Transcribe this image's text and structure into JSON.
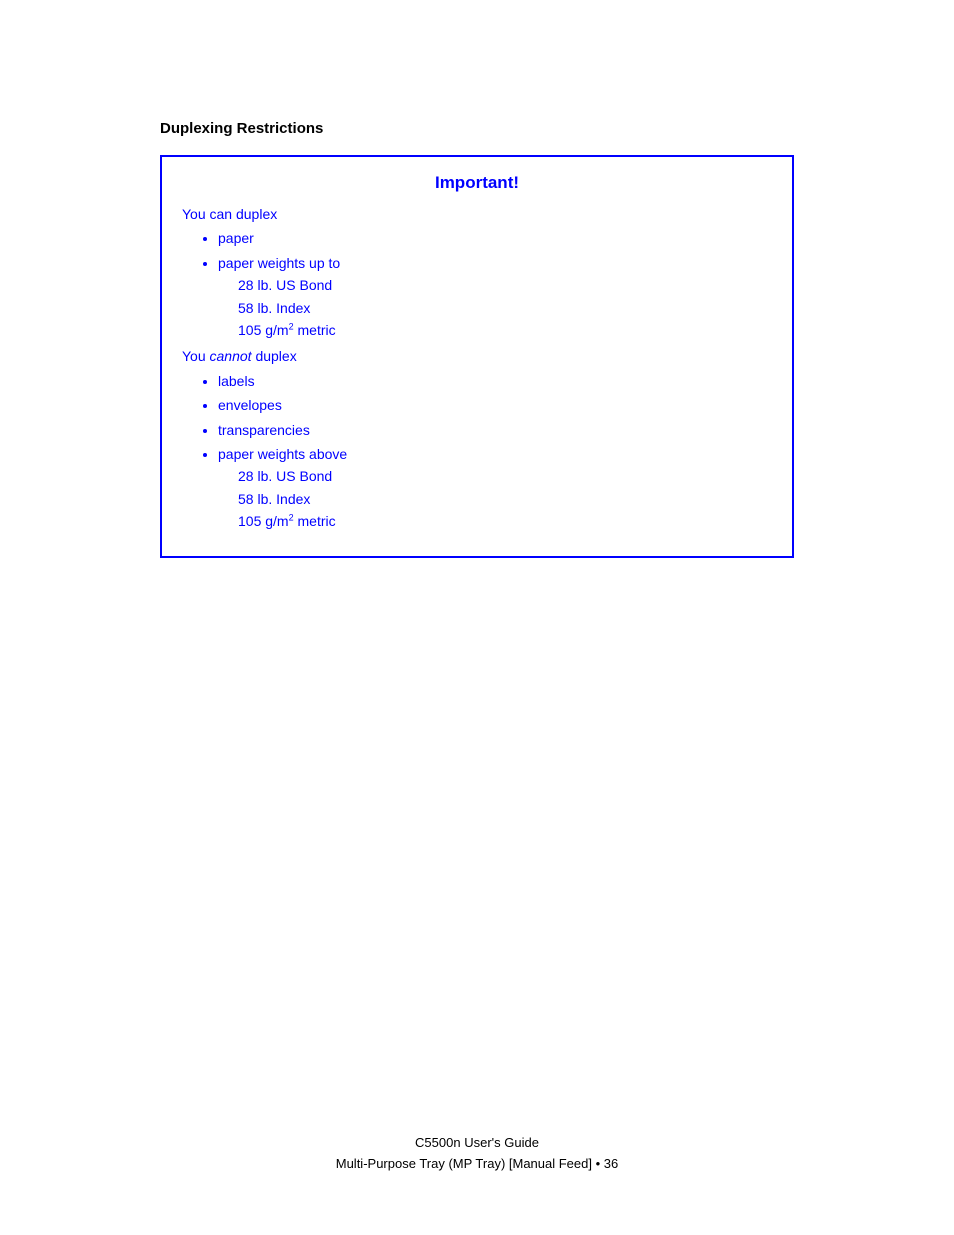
{
  "section": {
    "title": "Duplexing Restrictions"
  },
  "important_box": {
    "heading": "Important!",
    "can_duplex_label": "You can duplex",
    "can_duplex_items": [
      "paper",
      "paper weights up to"
    ],
    "can_duplex_sub": [
      "28 lb. US Bond",
      "58 lb. Index",
      "105 g/m² metric"
    ],
    "cannot_duplex_label_prefix": "You ",
    "cannot_duplex_label_italic": "cannot",
    "cannot_duplex_label_suffix": " duplex",
    "cannot_duplex_items": [
      "labels",
      "envelopes",
      "transparencies",
      "paper weights above"
    ],
    "cannot_duplex_sub": [
      "28 lb. US Bond",
      "58 lb. Index",
      "105 g/m² metric"
    ]
  },
  "footer": {
    "line1": "C5500n User's Guide",
    "line2": "Multi-Purpose Tray (MP Tray) [Manual Feed]  •  36"
  }
}
